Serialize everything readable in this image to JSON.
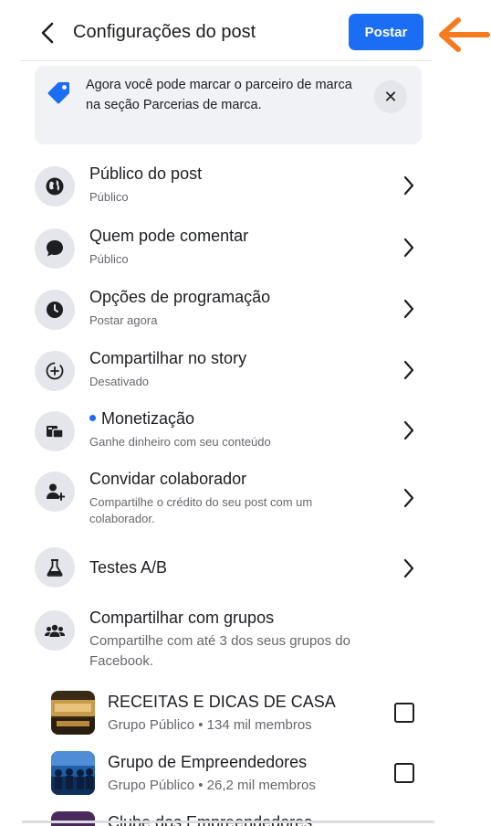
{
  "header": {
    "title": "Configurações do post",
    "post_button": "Postar"
  },
  "banner": {
    "text": "Agora você pode marcar o parceiro de marca na seção Parcerias de marca.",
    "close": "✕"
  },
  "settings": [
    {
      "title": "Público do post",
      "subtitle": "Público",
      "icon": "globe-icon"
    },
    {
      "title": "Quem pode comentar",
      "subtitle": "Público",
      "icon": "comment-icon"
    },
    {
      "title": "Opções de programação",
      "subtitle": "Postar agora",
      "icon": "clock-icon"
    },
    {
      "title": "Compartilhar no story",
      "subtitle": "Desativado",
      "icon": "story-plus-icon"
    },
    {
      "title": "Monetização",
      "subtitle": "Ganhe dinheiro com seu conteúdo",
      "icon": "monetization-icon"
    },
    {
      "title": "Convidar colaborador",
      "subtitle": "Compartilhe o crédito do seu post com um colaborador.",
      "icon": "add-person-icon"
    },
    {
      "title": "Testes A/B",
      "subtitle": "",
      "icon": "flask-icon"
    },
    {
      "title": "Compartilhar com grupos",
      "subtitle": "Compartilhe com até 3 dos seus grupos do Facebook.",
      "icon": "groups-icon"
    }
  ],
  "groups": [
    {
      "name": "RECEITAS E DICAS DE CASA",
      "info": "Grupo Público • 134 mil membros"
    },
    {
      "name": "Grupo de Empreendedores",
      "info": "Grupo Público • 26,2 mil membros"
    },
    {
      "name": "Clube dos Empreendedores",
      "info": ""
    }
  ],
  "colors": {
    "accent": "#1b6ef3",
    "arrow": "#f47b20"
  }
}
